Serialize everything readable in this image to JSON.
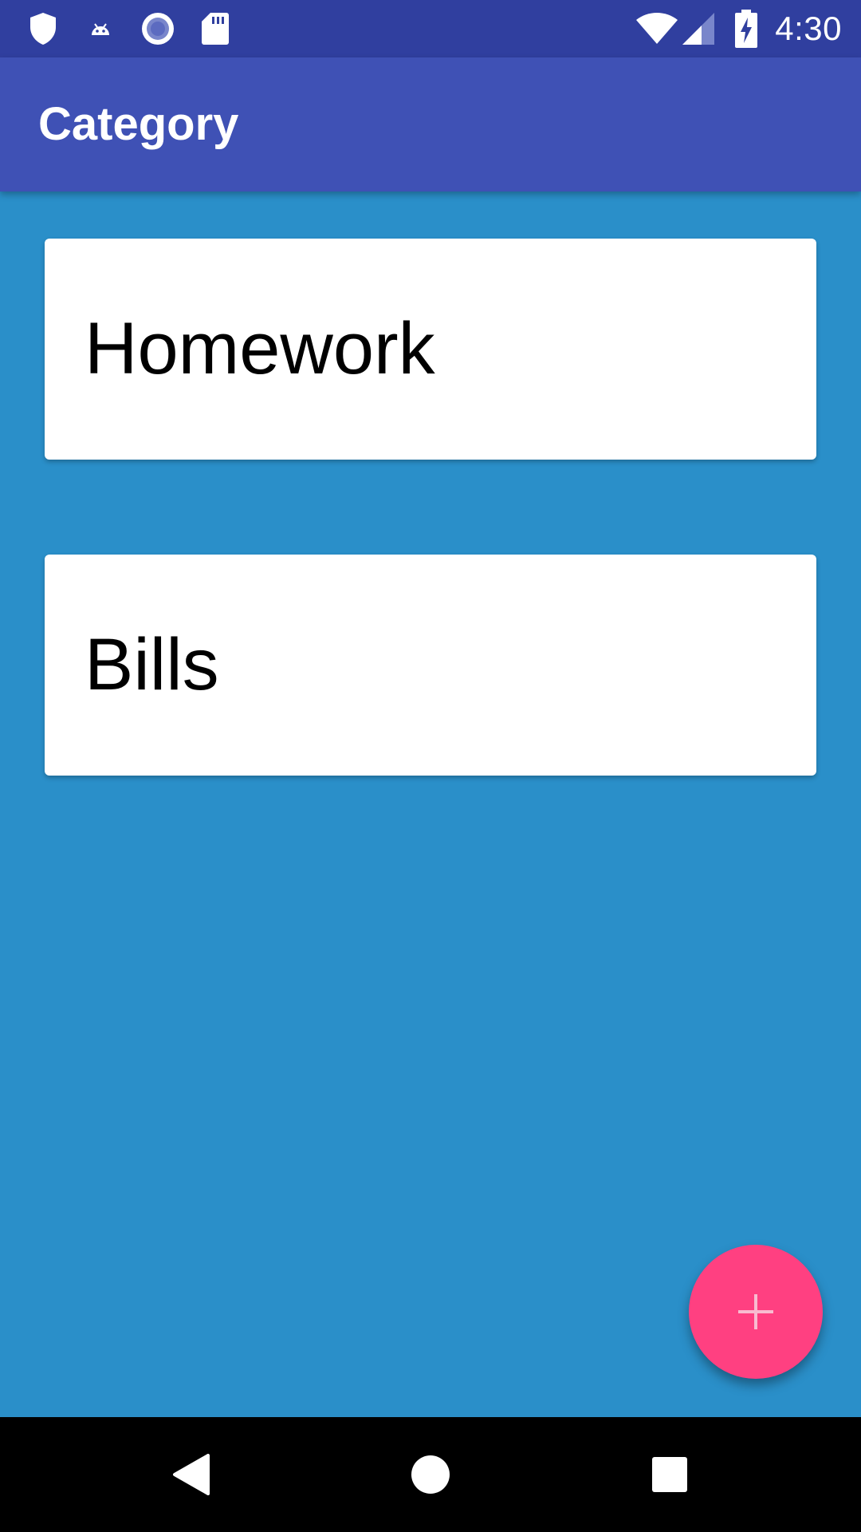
{
  "status_bar": {
    "time": "4:30",
    "left_icons": [
      "shield-icon",
      "android-debug-icon",
      "record-circle-icon",
      "sd-card-icon"
    ],
    "right_icons": [
      "wifi-icon",
      "cell-signal-icon",
      "battery-charging-icon"
    ]
  },
  "app_bar": {
    "title": "Category"
  },
  "categories": [
    {
      "label": "Homework"
    },
    {
      "label": "Bills"
    }
  ],
  "fab": {
    "icon": "plus-icon"
  },
  "nav_bar": {
    "buttons": [
      "back-icon",
      "home-icon",
      "recents-icon"
    ]
  },
  "colors": {
    "background": "#2a8fc9",
    "app_bar": "#3f51b5",
    "status_bar": "#303f9f",
    "fab": "#ff4081",
    "card": "#ffffff"
  }
}
